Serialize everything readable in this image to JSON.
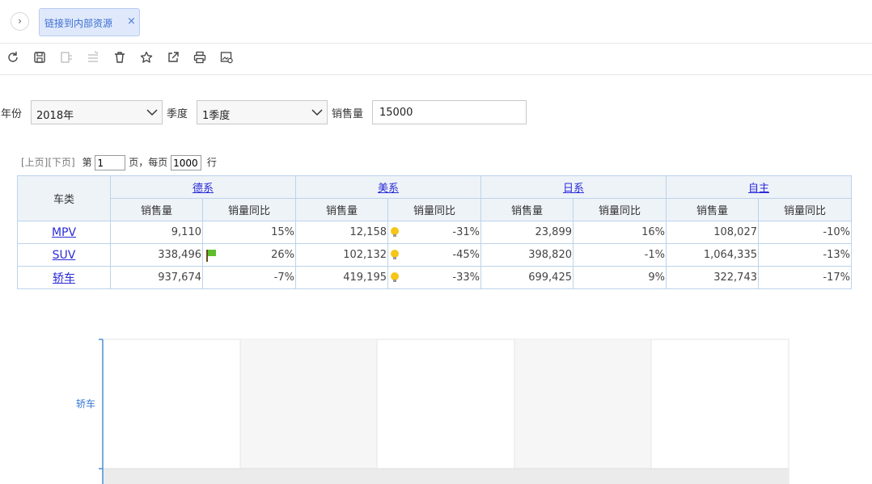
{
  "tab": {
    "label": "链接到内部资源",
    "close": "×"
  },
  "toolbar": {
    "icons": [
      "refresh-icon",
      "save-icon",
      "export-disabled-icon",
      "edit-disabled-icon",
      "delete-icon",
      "favorite-icon",
      "share-icon",
      "print-icon",
      "image-settings-icon"
    ]
  },
  "filters": {
    "year_label": "年份",
    "year_value": "2018年",
    "quarter_label": "季度",
    "quarter_value": "1季度",
    "sales_label": "销售量",
    "sales_value": "15000"
  },
  "pager": {
    "prev": "[上页]",
    "next": "[下页]",
    "page_prefix": "第",
    "page_value": "1",
    "page_suffix": "页，每页",
    "rows_value": "1000",
    "rows_suffix": "行"
  },
  "table": {
    "corner": "车类",
    "groups": [
      "德系",
      "美系",
      "日系",
      "自主"
    ],
    "sub_headers": [
      "销售量",
      "销量同比"
    ],
    "rows": [
      {
        "category": "MPV",
        "cells": [
          {
            "sales": "9,110",
            "yoy": "15%",
            "icon": ""
          },
          {
            "sales": "12,158",
            "yoy": "-31%",
            "icon": "bulb"
          },
          {
            "sales": "23,899",
            "yoy": "16%",
            "icon": ""
          },
          {
            "sales": "108,027",
            "yoy": "-10%",
            "icon": ""
          }
        ]
      },
      {
        "category": "SUV",
        "cells": [
          {
            "sales": "338,496",
            "yoy": "26%",
            "icon": "flag"
          },
          {
            "sales": "102,132",
            "yoy": "-45%",
            "icon": "bulb"
          },
          {
            "sales": "398,820",
            "yoy": "-1%",
            "icon": ""
          },
          {
            "sales": "1,064,335",
            "yoy": "-13%",
            "icon": ""
          }
        ]
      },
      {
        "category": "轿车",
        "cells": [
          {
            "sales": "937,674",
            "yoy": "-7%",
            "icon": ""
          },
          {
            "sales": "419,195",
            "yoy": "-33%",
            "icon": "bulb"
          },
          {
            "sales": "699,425",
            "yoy": "9%",
            "icon": ""
          },
          {
            "sales": "322,743",
            "yoy": "-17%",
            "icon": ""
          }
        ]
      }
    ]
  },
  "chart": {
    "category_labels": [
      "轿车"
    ],
    "axis_color": "#4a90d9",
    "label_color": "#3a7bd5"
  },
  "colors": {
    "accent": "#3d6fd0",
    "link": "#2b2bd8",
    "header_bg": "#eef3f8",
    "border": "#bcd3ea"
  }
}
